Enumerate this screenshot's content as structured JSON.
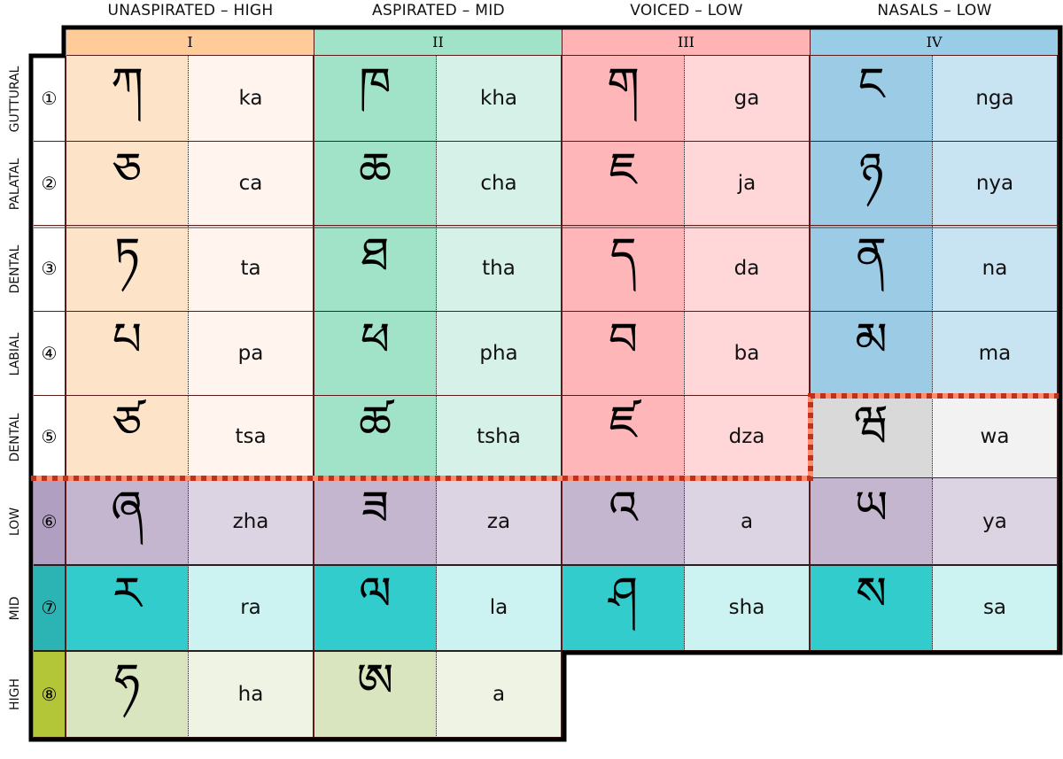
{
  "column_headers": [
    "UNASPIRATED – HIGH",
    "ASPIRATED – MID",
    "VOICED – LOW",
    "NASALS – LOW"
  ],
  "column_numerals": [
    "I",
    "II",
    "III",
    "IV"
  ],
  "column_colors": {
    "header": [
      "#ffcc99",
      "#a0e3c9",
      "#ffb3b5",
      "#99cde7"
    ],
    "glyph": [
      "#fde3c8",
      "#a0e3c9",
      "#ffb6b8",
      "#9ccbe5"
    ],
    "latin": [
      "#fff4ee",
      "#d5f1e8",
      "#ffd7d9",
      "#c8e3f2"
    ]
  },
  "rows": [
    {
      "label": "GUTTURAL",
      "number": "①",
      "cells": [
        [
          "ཀ",
          "ka"
        ],
        [
          "ཁ",
          "kha"
        ],
        [
          "ག",
          "ga"
        ],
        [
          "ང",
          "nga"
        ]
      ]
    },
    {
      "label": "PALATAL",
      "number": "②",
      "cells": [
        [
          "ཅ",
          "ca"
        ],
        [
          "ཆ",
          "cha"
        ],
        [
          "ཇ",
          "ja"
        ],
        [
          "ཉ",
          "nya"
        ]
      ]
    },
    {
      "label": "DENTAL",
      "number": "③",
      "cells": [
        [
          "ཏ",
          "ta"
        ],
        [
          "ཐ",
          "tha"
        ],
        [
          "ད",
          "da"
        ],
        [
          "ན",
          "na"
        ]
      ]
    },
    {
      "label": "LABIAL",
      "number": "④",
      "cells": [
        [
          "པ",
          "pa"
        ],
        [
          "ཕ",
          "pha"
        ],
        [
          "བ",
          "ba"
        ],
        [
          "མ",
          "ma"
        ]
      ]
    },
    {
      "label": "DENTAL",
      "number": "⑤",
      "cells": [
        [
          "ཙ",
          "tsa"
        ],
        [
          "ཚ",
          "tsha"
        ],
        [
          "ཛ",
          "dza"
        ],
        [
          "ཝ",
          "wa"
        ]
      ],
      "last_cell_colors": {
        "glyph": "#d9d9d9",
        "latin": "#f2f2f2"
      }
    },
    {
      "label": "LOW",
      "number": "⑥",
      "cells": [
        [
          "ཞ",
          "zha"
        ],
        [
          "ཟ",
          "za"
        ],
        [
          "འ",
          "a"
        ],
        [
          "ཡ",
          "ya"
        ]
      ],
      "colors": {
        "number": "#b09fc0",
        "glyph": "#c4b6cf",
        "latin": "#dcd4e3"
      }
    },
    {
      "label": "MID",
      "number": "⑦",
      "cells": [
        [
          "ར",
          "ra"
        ],
        [
          "ལ",
          "la"
        ],
        [
          "ཤ",
          "sha"
        ],
        [
          "ས",
          "sa"
        ]
      ],
      "colors": {
        "number": "#2cb3b3",
        "glyph": "#33cccc",
        "latin": "#ccf2f2"
      }
    },
    {
      "label": "HIGH",
      "number": "⑧",
      "cells": [
        [
          "ཧ",
          "ha"
        ],
        [
          "ཨ",
          "a"
        ]
      ],
      "colors": {
        "number": "#b3c637",
        "glyph": "#d9e5be",
        "latin": "#eff3e4"
      }
    }
  ],
  "divider_colors": {
    "dash_dark": "#c0301a",
    "dash_light": "#ff8c6c"
  }
}
